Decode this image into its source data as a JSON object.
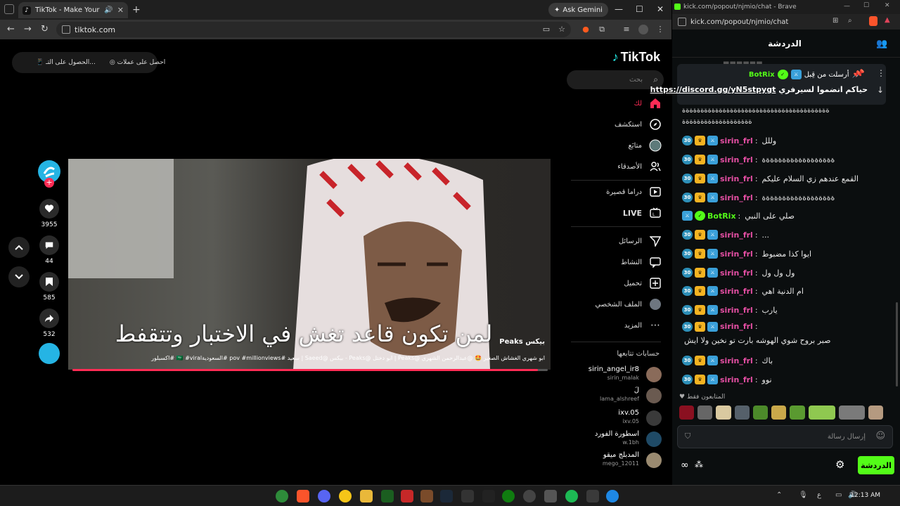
{
  "browser": {
    "tab_title": "TikTok - Make Your Day",
    "url": "tiktok.com",
    "gemini_label": "Ask Gemini"
  },
  "tiktok": {
    "logo": "TikTok",
    "top_btn_1": "احصل على عملات",
    "top_btn_2": "الحصول على التـ...",
    "search_placeholder": "بحث",
    "nav": [
      {
        "label": "لك",
        "icon": "home-icon"
      },
      {
        "label": "استكشف",
        "icon": "compass-icon"
      },
      {
        "label": "متابَع",
        "icon": "avatar-icon"
      },
      {
        "label": "الأصدقاء",
        "icon": "friends-icon"
      },
      {
        "label": "دراما قصيرة",
        "icon": "drama-icon"
      },
      {
        "label": "LIVE",
        "icon": "live-icon"
      },
      {
        "label": "الرسائل",
        "icon": "send-icon"
      },
      {
        "label": "النشاط",
        "icon": "activity-icon"
      },
      {
        "label": "تحميل",
        "icon": "upload-icon"
      },
      {
        "label": "الملف الشخصي",
        "icon": "profile-icon"
      },
      {
        "label": "المزيد",
        "icon": "more-icon"
      }
    ],
    "following_title": "حسابات تتابعها",
    "following": [
      {
        "name": "sirin_angel_ir8",
        "user": "sirin_malak"
      },
      {
        "name": "لَ",
        "user": "lama_alshreef"
      },
      {
        "name": "ixv.05",
        "user": "ixv.05"
      },
      {
        "name": "اسطورة الفورد",
        "user": "w.1bh"
      },
      {
        "name": "المدبلج ميقو",
        "user": "mego_12011"
      }
    ],
    "actions": {
      "likes": "3955",
      "comments": "44",
      "saves": "585",
      "shares": "532"
    },
    "video": {
      "caption": "لمن تكون قاعد تغش في الاختبار وتتقفط",
      "watermark": "Peaks بيكس",
      "description": "ابو شهري الغشاش الصغير 🤩 @عبدالرحمن الشهري @Peaks | ابو دختل @Peaks - بيكس @Saeed | سعيد #pov #millionviews #السعودية🇸🇦 #viral #اكسبلور",
      "progress_percent": 98
    }
  },
  "kick": {
    "window_title": "kick.com/popout/njmio/chat - Brave",
    "url": "kick.com/popout/njmio/chat",
    "header": "الدردشة",
    "pinned": {
      "by_label": "أرسلت من قِبل",
      "user": "BotRix",
      "text_prefix": "حياكم انضموا لسيرفري",
      "link": "https://discord.gg/yN5stpygt"
    },
    "overflow_line_1": "ةةةةةةةةةةةةةةةةةةةةةةةةةةةةةةةةةةةةةةةة",
    "overflow_line_2": "ةةةةةةةةةةةةةةةةةةة",
    "messages": [
      {
        "user": "sirin_frl",
        "text": "وللل",
        "badges": "sub-crown-mod",
        "color": "#e64fa4"
      },
      {
        "user": "sirin_frl",
        "text": "ةةةةةةةةةةةةةةةةةة",
        "badges": "sub-crown-mod",
        "color": "#e64fa4"
      },
      {
        "user": "sirin_frl",
        "text": "القمع عندهم زي السلام عليكم",
        "badges": "sub-crown-mod",
        "color": "#e64fa4"
      },
      {
        "user": "sirin_frl",
        "text": "ةةةةةةةةةةةةةةةةةة",
        "badges": "sub-crown-mod",
        "color": "#e64fa4"
      },
      {
        "user": "BotRix",
        "text": "صلي على النبي",
        "badges": "mod-verified",
        "color": "#53fc18"
      },
      {
        "user": "sirin_frl",
        "text": "...",
        "badges": "sub-crown-mod",
        "color": "#e64fa4"
      },
      {
        "user": "sirin_frl",
        "text": "ايوا كذا مضبوط",
        "badges": "sub-crown-mod",
        "color": "#e64fa4"
      },
      {
        "user": "sirin_frl",
        "text": "ول ول ول",
        "badges": "sub-crown-mod",
        "color": "#e64fa4"
      },
      {
        "user": "sirin_frl",
        "text": "ام الدنية اهي",
        "badges": "sub-crown-mod",
        "color": "#e64fa4"
      },
      {
        "user": "sirin_frl",
        "text": "يارب",
        "badges": "sub-crown-mod",
        "color": "#e64fa4"
      },
      {
        "user": "sirin_frl",
        "text": "صبر بروح شوي الهوشه بارت تو نخين ولا ايش",
        "badges": "sub-crown-mod",
        "color": "#e64fa4"
      },
      {
        "user": "sirin_frl",
        "text": "باك",
        "badges": "sub-crown-mod",
        "color": "#e64fa4"
      },
      {
        "user": "sirin_frl",
        "text": "نوو",
        "badges": "sub-crown-mod",
        "color": "#e64fa4"
      }
    ],
    "followers_only": "المتابعون فقط",
    "input_placeholder": "إرسال رسالة",
    "send_label": "الدردشة"
  },
  "taskbar": {
    "clock": "12:13 AM",
    "lang": "ع"
  },
  "colors": {
    "kick_green": "#53fc18",
    "tiktok_red": "#fe2c55",
    "chat_user": "#e64fa4"
  }
}
